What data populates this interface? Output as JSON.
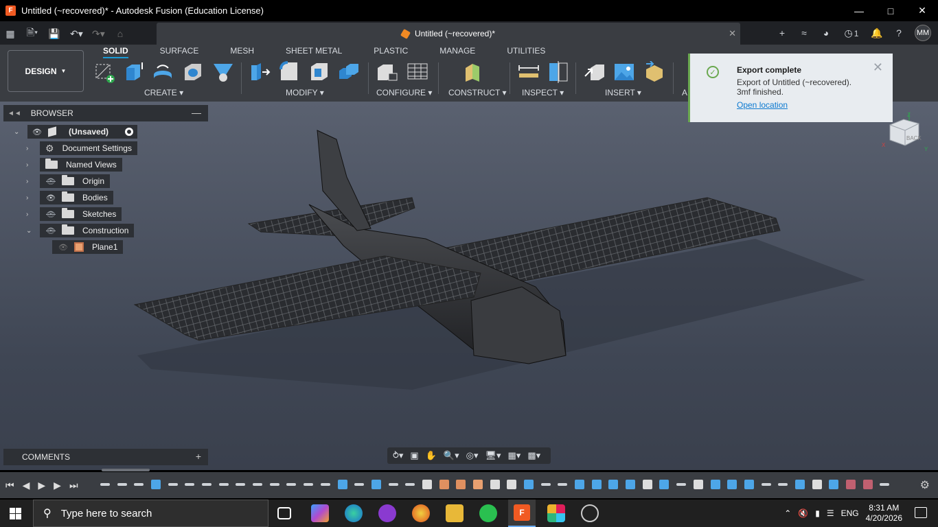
{
  "window": {
    "title": "Untitled (~recovered)* - Autodesk Fusion (Education License)",
    "minimize": "—",
    "maximize": "□",
    "close": "✕"
  },
  "tabbar": {
    "doc_tab_label": "Untitled (~recovered)*",
    "close_tab": "✕",
    "jobs_count": "1",
    "avatar": "MM"
  },
  "toolbar": {
    "workspace": "DESIGN",
    "tabs": [
      "SOLID",
      "SURFACE",
      "MESH",
      "SHEET METAL",
      "PLASTIC",
      "MANAGE",
      "UTILITIES"
    ],
    "groups": {
      "create": "CREATE",
      "modify": "MODIFY",
      "configure": "CONFIGURE",
      "construct": "CONSTRUCT",
      "inspect": "INSPECT",
      "insert": "INSERT",
      "truncated": "A"
    }
  },
  "browser": {
    "title": "BROWSER",
    "root": "(Unsaved)",
    "items": [
      {
        "label": "Document Settings"
      },
      {
        "label": "Named Views"
      },
      {
        "label": "Origin"
      },
      {
        "label": "Bodies"
      },
      {
        "label": "Sketches"
      },
      {
        "label": "Construction"
      },
      {
        "label": "Plane1"
      }
    ]
  },
  "comments": {
    "title": "COMMENTS"
  },
  "notification": {
    "title": "Export complete",
    "message": "Export of Untitled (~recovered). 3mf finished.",
    "link": "Open location"
  },
  "viewcube": {
    "face": "BACK",
    "axes": [
      "Z",
      "X",
      "Y"
    ]
  },
  "taskbar": {
    "search_placeholder": "Type here to search",
    "language": "ENG",
    "time": "8:31 AM",
    "date": "4/20/2026",
    "fusion_label": "F"
  },
  "colors": {
    "accent": "#1a9bd7",
    "success": "#6aa84f",
    "fusion_orange": "#f15a22"
  }
}
